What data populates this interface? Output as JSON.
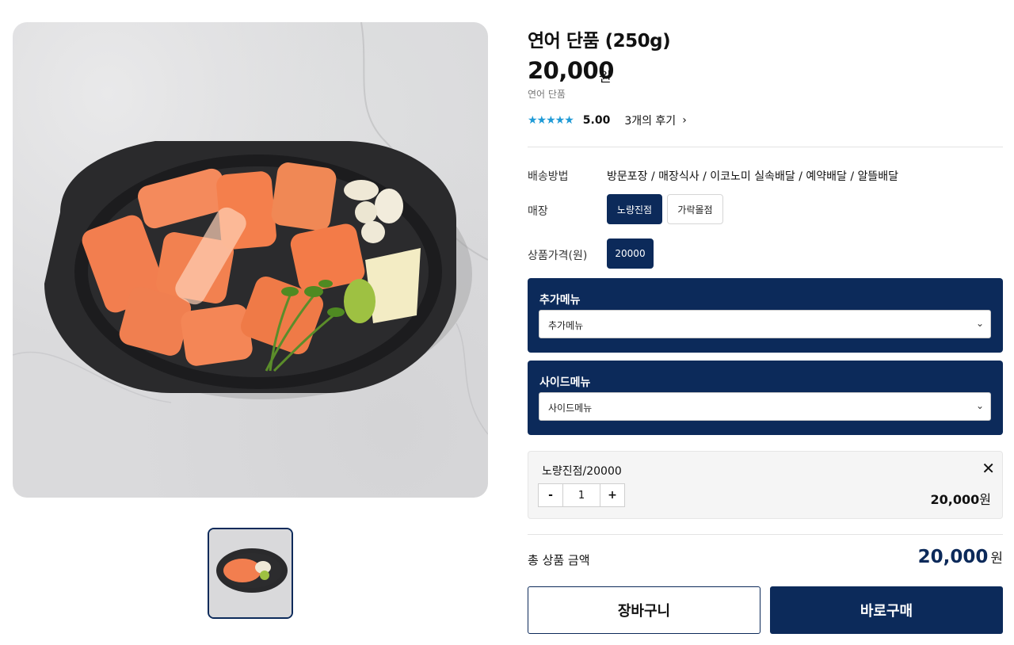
{
  "product": {
    "title": "연어 단품 (250g)",
    "price": "20,000",
    "price_unit": "원",
    "subname": "연어 단품",
    "stars": "★★★★★",
    "rating": "5.00",
    "reviews_label": "3개의 후기",
    "images": [
      "salmon-bowl-photo"
    ]
  },
  "options": {
    "delivery_label": "배송방법",
    "delivery_value": "방문포장 / 매장식사 / 이코노미 실속배달 / 예약배달 / 알뜰배달",
    "store_label": "매장",
    "stores": [
      "노량진점",
      "가락몰점"
    ],
    "selected_store_index": 0,
    "price_label": "상품가격(원)",
    "price_options": [
      "20000"
    ],
    "extra_menu_label": "추가메뉴",
    "extra_menu_value": "추가메뉴",
    "side_menu_label": "사이드메뉴",
    "side_menu_value": "사이드메뉴"
  },
  "cart_item": {
    "name": "노량진점/20000",
    "minus": "-",
    "qty": "1",
    "plus": "+",
    "price": "20,000",
    "unit": "원",
    "close": "✕"
  },
  "total": {
    "label": "총 상품 금액",
    "amount": "20,000",
    "unit": "원"
  },
  "buttons": {
    "cart": "장바구니",
    "buy": "바로구매"
  },
  "colors": {
    "brand_navy": "#0c2a5a",
    "star_blue": "#1f9ad6"
  }
}
